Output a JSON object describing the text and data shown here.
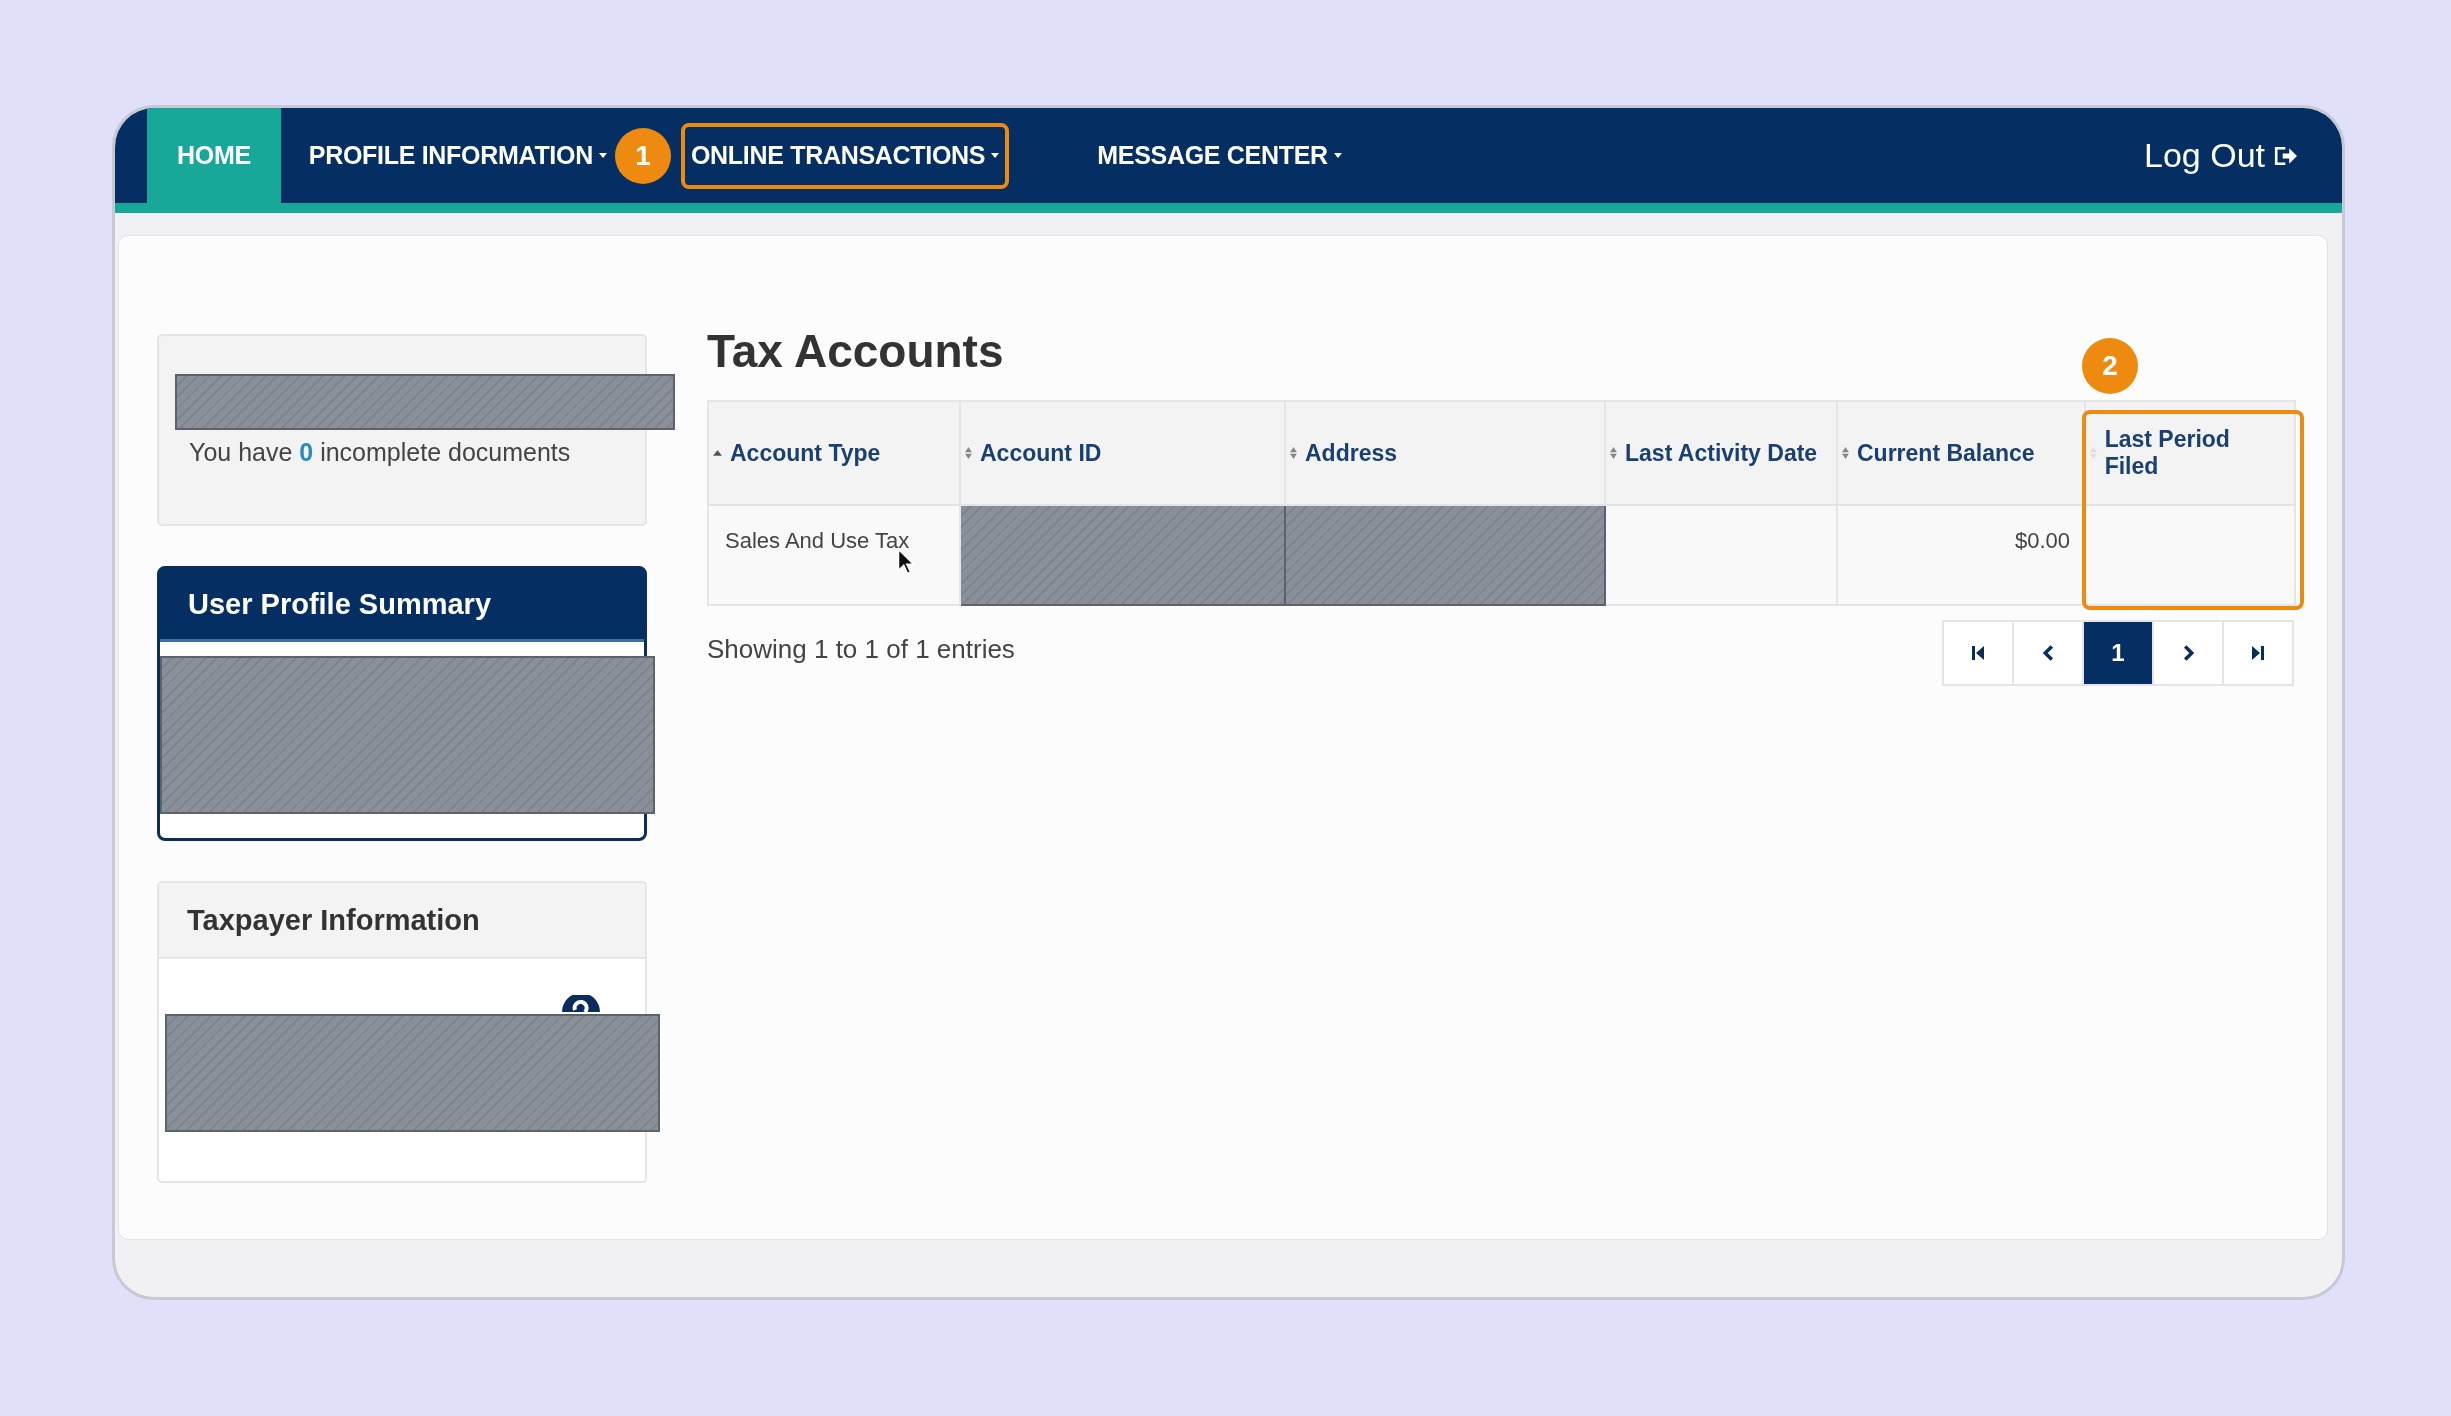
{
  "nav": {
    "items": [
      {
        "label": "HOME",
        "kind": "tab",
        "selected": true,
        "highlighted": false
      },
      {
        "label": "PROFILE INFORMATION",
        "kind": "menu",
        "selected": false,
        "highlighted": false,
        "callout_after": "1"
      },
      {
        "label": "ONLINE TRANSACTIONS",
        "kind": "menu",
        "selected": false,
        "highlighted": true
      },
      {
        "label": "MESSAGE CENTER",
        "kind": "menu",
        "selected": false,
        "highlighted": false
      }
    ],
    "logout": "Log Out"
  },
  "sidebar": {
    "documents": {
      "prefix": "You have",
      "count": "0",
      "suffix": "incomplete documents"
    },
    "profile_summary": {
      "title": "User Profile Summary"
    },
    "taxpayer_info": {
      "title": "Taxpayer Information"
    }
  },
  "tax_accounts": {
    "title": "Tax Accounts",
    "columns": [
      {
        "label": "Account Type",
        "sorted": true,
        "highlighted": false
      },
      {
        "label": "Account ID",
        "sorted": false,
        "highlighted": false
      },
      {
        "label": "Address",
        "sorted": false,
        "highlighted": false
      },
      {
        "label": "Last Activity Date",
        "sorted": false,
        "highlighted": false
      },
      {
        "label": "Current Balance",
        "sorted": false,
        "highlighted": false
      },
      {
        "label": "Last Period Filed",
        "sorted": false,
        "highlighted": true,
        "callout": "2"
      }
    ],
    "rows": [
      {
        "cells": [
          {
            "kind": "text",
            "text": "Sales And Use Tax"
          },
          {
            "kind": "redacted"
          },
          {
            "kind": "redacted"
          },
          {
            "kind": "empty"
          },
          {
            "kind": "amount",
            "text": "$0.00"
          },
          {
            "kind": "empty"
          }
        ]
      }
    ],
    "summary": "Showing 1 to 1 of 1 entries",
    "pagination": [
      {
        "kind": "first",
        "selected": false
      },
      {
        "kind": "prev",
        "selected": false
      },
      {
        "kind": "page",
        "label": "1",
        "selected": true
      },
      {
        "kind": "next",
        "selected": false
      },
      {
        "kind": "last",
        "selected": false
      }
    ]
  }
}
